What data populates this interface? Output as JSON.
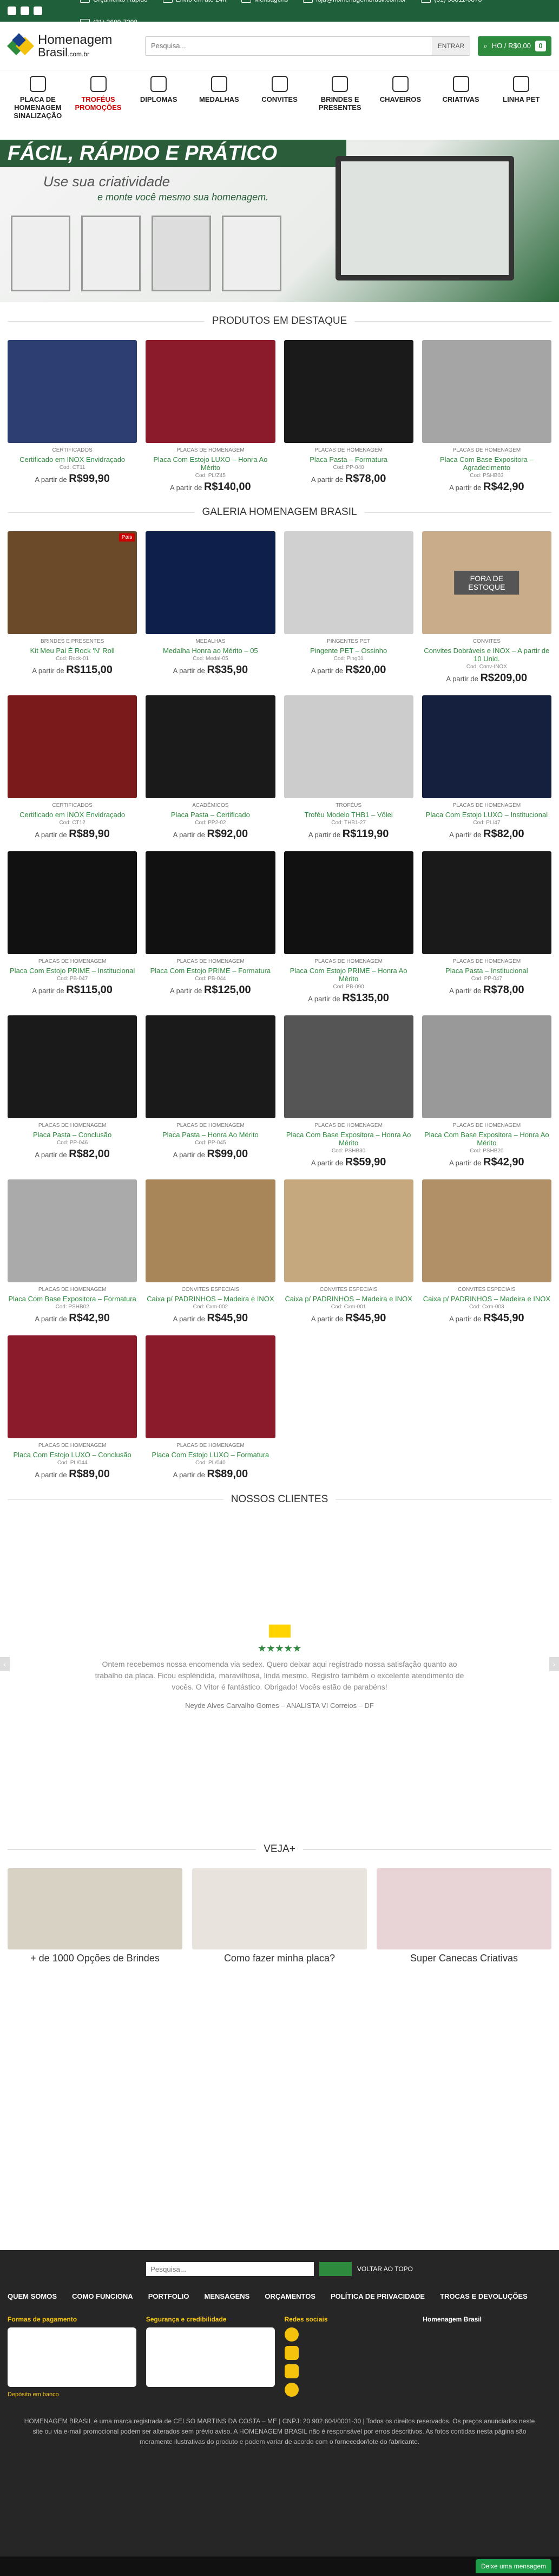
{
  "topbar": {
    "items": [
      "Orçamento Rápido",
      "Envio em até 24h",
      "Mensagens",
      "loja@homenagembrasil.com.br",
      "(31) 98811-0878",
      "(31) 3689-7298"
    ]
  },
  "header": {
    "logo_t1": "Homenagem",
    "logo_t2": "Brasil",
    "logo_suffix": ".com.br",
    "search_placeholder": "Pesquisa...",
    "search_button": "ENTRAR",
    "cart_label": "HO / R$0,00",
    "cart_count": "0"
  },
  "nav": [
    {
      "label": "PLACA DE HOMENAGEM SINALIZAÇÃO",
      "icon": "plaque-icon",
      "promo": false
    },
    {
      "label": "TROFÉUS PROMOÇÕES",
      "icon": "trophy-icon",
      "promo": true
    },
    {
      "label": "DIPLOMAS",
      "icon": "diploma-icon",
      "promo": false
    },
    {
      "label": "MEDALHAS",
      "icon": "medal-icon",
      "promo": false
    },
    {
      "label": "CONVITES",
      "icon": "invite-icon",
      "promo": false
    },
    {
      "label": "BRINDES E PRESENTES",
      "icon": "gift-icon",
      "promo": false
    },
    {
      "label": "CHAVEIROS",
      "icon": "keychain-icon",
      "promo": false
    },
    {
      "label": "CRIATIVAS",
      "icon": "creative-icon",
      "promo": false
    },
    {
      "label": "LINHA PET",
      "icon": "paw-icon",
      "promo": false
    }
  ],
  "hero": {
    "headline": "FÁCIL, RÁPIDO E PRÁTICO",
    "sub1": "Use sua criatividade",
    "sub2": "e monte você mesmo sua homenagem."
  },
  "sections": {
    "destaque": "PRODUTOS EM DESTAQUE",
    "galeria": "GALERIA HOMENAGEM BRASIL",
    "clientes": "NOSSOS CLIENTES",
    "veja": "VEJA+"
  },
  "destaque": [
    {
      "cat": "CERTIFICADOS",
      "name": "Certificado em INOX Envidraçado",
      "code": "Cod: CT11",
      "prefix": "A partir de",
      "price": "R$99,90",
      "color": "#2c3e72"
    },
    {
      "cat": "PLACAS DE HOMENAGEM",
      "name": "Placa Com Estojo LUXO – Honra Ao Mérito",
      "code": "Cod: PL/Z45",
      "prefix": "A partir de",
      "price": "R$140,00",
      "color": "#8b1a2a"
    },
    {
      "cat": "PLACAS DE HOMENAGEM",
      "name": "Placa Pasta – Formatura",
      "code": "Cod: PP-040",
      "prefix": "A partir de",
      "price": "R$78,00",
      "color": "#1a1a1a"
    },
    {
      "cat": "PLACAS DE HOMENAGEM",
      "name": "Placa Com Base Expositora – Agradecimento",
      "code": "Cod: PSHB03",
      "prefix": "A partir de",
      "price": "R$42,90",
      "color": "#a5a5a5"
    }
  ],
  "galeria": [
    {
      "cat": "BRINDES E PRESENTES",
      "name": "Kit Meu Pai É Rock 'N' Roll",
      "code": "Cod: Rock-01",
      "prefix": "A partir de",
      "price": "R$115,00",
      "color": "#6b4a2a",
      "tag": "Pais",
      "stock": ""
    },
    {
      "cat": "MEDALHAS",
      "name": "Medalha Honra ao Mérito – 05",
      "code": "Cod: Medal-05",
      "prefix": "A partir de",
      "price": "R$35,90",
      "color": "#0d1f4a",
      "tag": "",
      "stock": ""
    },
    {
      "cat": "PINGENTES PET",
      "name": "Pingente PET – Ossinho",
      "code": "Cod: Ping01",
      "prefix": "A partir de",
      "price": "R$20,00",
      "color": "#d0d0d0",
      "tag": "",
      "stock": ""
    },
    {
      "cat": "CONVITES",
      "name": "Convites Dobráveis e INOX – A partir de 10 Unid.",
      "code": "Cod: Conv-INOX",
      "prefix": "A partir de",
      "price": "R$209,00",
      "color": "#c9ad8a",
      "tag": "",
      "stock": "FORA DE ESTOQUE"
    },
    {
      "cat": "CERTIFICADOS",
      "name": "Certificado em INOX Envidraçado",
      "code": "Cod: CT12",
      "prefix": "A partir de",
      "price": "R$89,90",
      "color": "#7a1a1a",
      "tag": "",
      "stock": ""
    },
    {
      "cat": "ACADÊMICOS",
      "name": "Placa Pasta – Certificado",
      "code": "Cod: PP2-02",
      "prefix": "A partir de",
      "price": "R$92,00",
      "color": "#1a1a1a",
      "tag": "",
      "stock": ""
    },
    {
      "cat": "TROFÉUS",
      "name": "Troféu Modelo THB1 – Vôlei",
      "code": "Cod: THB1-27",
      "prefix": "A partir de",
      "price": "R$119,90",
      "color": "#cccccc",
      "tag": "",
      "stock": ""
    },
    {
      "cat": "PLACAS DE HOMENAGEM",
      "name": "Placa Com Estojo LUXO – Institucional",
      "code": "Cod: PL/47",
      "prefix": "A partir de",
      "price": "R$82,00",
      "color": "#15203f",
      "tag": "",
      "stock": ""
    },
    {
      "cat": "PLACAS DE HOMENAGEM",
      "name": "Placa Com Estojo PRIME – Institucional",
      "code": "Cod: PB-047",
      "prefix": "A partir de",
      "price": "R$115,00",
      "color": "#111111",
      "tag": "",
      "stock": ""
    },
    {
      "cat": "PLACAS DE HOMENAGEM",
      "name": "Placa Com Estojo PRIME – Formatura",
      "code": "Cod: PB-044",
      "prefix": "A partir de",
      "price": "R$125,00",
      "color": "#111111",
      "tag": "",
      "stock": ""
    },
    {
      "cat": "PLACAS DE HOMENAGEM",
      "name": "Placa Com Estojo PRIME – Honra Ao Mérito",
      "code": "Cod: PB-090",
      "prefix": "A partir de",
      "price": "R$135,00",
      "color": "#111111",
      "tag": "",
      "stock": ""
    },
    {
      "cat": "PLACAS DE HOMENAGEM",
      "name": "Placa Pasta – Institucional",
      "code": "Cod: PP-047",
      "prefix": "A partir de",
      "price": "R$78,00",
      "color": "#1a1a1a",
      "tag": "",
      "stock": ""
    },
    {
      "cat": "PLACAS DE HOMENAGEM",
      "name": "Placa Pasta – Conclusão",
      "code": "Cod: PP-046",
      "prefix": "A partir de",
      "price": "R$82,00",
      "color": "#1a1a1a",
      "tag": "",
      "stock": ""
    },
    {
      "cat": "PLACAS DE HOMENAGEM",
      "name": "Placa Pasta – Honra Ao Mérito",
      "code": "Cod: PP-045",
      "prefix": "A partir de",
      "price": "R$99,00",
      "color": "#1a1a1a",
      "tag": "",
      "stock": ""
    },
    {
      "cat": "PLACAS DE HOMENAGEM",
      "name": "Placa Com Base Expositora – Honra Ao Mérito",
      "code": "Cod: PSHB30",
      "prefix": "A partir de",
      "price": "R$59,90",
      "color": "#555555",
      "tag": "",
      "stock": ""
    },
    {
      "cat": "PLACAS DE HOMENAGEM",
      "name": "Placa Com Base Expositora – Honra Ao Mérito",
      "code": "Cod: PSHB20",
      "prefix": "A partir de",
      "price": "R$42,90",
      "color": "#999999",
      "tag": "",
      "stock": ""
    },
    {
      "cat": "PLACAS DE HOMENAGEM",
      "name": "Placa Com Base Expositora – Formatura",
      "code": "Cod: PSHB02",
      "prefix": "A partir de",
      "price": "R$42,90",
      "color": "#aaaaaa",
      "tag": "",
      "stock": ""
    },
    {
      "cat": "CONVITES ESPECIAIS",
      "name": "Caixa p/ PADRINHOS – Madeira e INOX",
      "code": "Cod: Cxm-002",
      "prefix": "A partir de",
      "price": "R$45,90",
      "color": "#a8865a",
      "tag": "",
      "stock": ""
    },
    {
      "cat": "CONVITES ESPECIAIS",
      "name": "Caixa p/ PADRINHOS – Madeira e INOX",
      "code": "Cod: Cxm-001",
      "prefix": "A partir de",
      "price": "R$45,90",
      "color": "#c6a87e",
      "tag": "",
      "stock": ""
    },
    {
      "cat": "CONVITES ESPECIAIS",
      "name": "Caixa p/ PADRINHOS – Madeira e INOX",
      "code": "Cod: Cxm-003",
      "prefix": "A partir de",
      "price": "R$45,90",
      "color": "#b29067",
      "tag": "",
      "stock": ""
    },
    {
      "cat": "PLACAS DE HOMENAGEM",
      "name": "Placa Com Estojo LUXO – Conclusão",
      "code": "Cod: PL/044",
      "prefix": "A partir de",
      "price": "R$89,00",
      "color": "#8b1a2a",
      "tag": "",
      "stock": ""
    },
    {
      "cat": "PLACAS DE HOMENAGEM",
      "name": "Placa Com Estojo LUXO – Formatura",
      "code": "Cod: PL/040",
      "prefix": "A partir de",
      "price": "R$89,00",
      "color": "#8b1a2a",
      "tag": "",
      "stock": ""
    }
  ],
  "testimonial": {
    "stars": "★★★★★",
    "quote": "Ontem recebemos nossa encomenda via sedex. Quero deixar aqui registrado nossa satisfação quanto ao trabalho da placa. Ficou espléndida, maravilhosa, linda mesmo. Registro também o excelente atendimento de vocês. O Vitor é fantástico. Obrigado! Vocês estão de parabéns!",
    "author": "Neyde Alves Carvalho Gomes – ANALISTA VI  Correios – DF"
  },
  "veja": [
    {
      "title": "+ de 1000 Opções de Brindes",
      "color": "#d8d2c4"
    },
    {
      "title": "Como fazer minha placa?",
      "color": "#e9e3dd"
    },
    {
      "title": "Super Canecas Criativas",
      "color": "#e8d4d6"
    }
  ],
  "footer": {
    "search_placeholder": "Pesquisa...",
    "top_label": "VOLTAR AO TOPO",
    "nav": [
      "QUEM SOMOS",
      "COMO FUNCIONA",
      "PORTFOLIO",
      "MENSAGENS",
      "ORÇAMENTOS",
      "POLÍTICA DE PRIVACIDADE",
      "TROCAS E DEVOLUÇÕES"
    ],
    "col1": "Formas de pagamento",
    "col1b": "Depósito em banco",
    "col2": "Segurança e credibilidade",
    "col3": "Redes sociais",
    "col4": "Homenagem Brasil",
    "legal": "HOMENAGEM BRASIL é uma marca registrada de CELSO MARTINS DA COSTA – ME | CNPJ: 20.902.604/0001-30 | Todos os direitos reservados. Os preços anunciados neste site ou via e-mail promocional podem ser alterados sem prévio aviso. A HOMENAGEM BRASIL não é responsável por erros descritivos. As fotos contidas nesta página são meramente ilustrativas do produto e podem variar de acordo com o fornecedor/lote do fabricante.",
    "chat": "Deixe uma mensagem"
  }
}
